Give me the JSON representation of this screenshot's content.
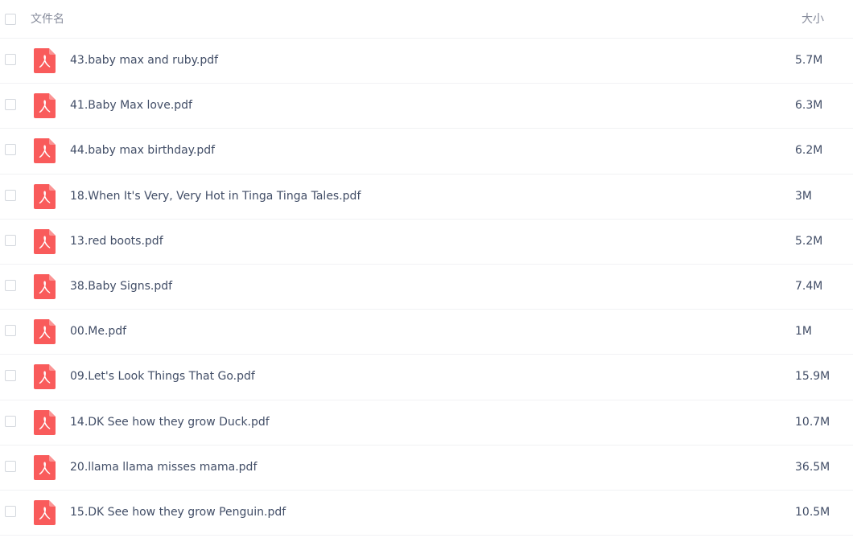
{
  "header": {
    "name_label": "文件名",
    "size_label": "大小"
  },
  "colors": {
    "pdf_icon": "#f95b5b",
    "divider": "#f1f2f4",
    "header_text": "#878c9c",
    "body_text": "#424e67"
  },
  "files": [
    {
      "name": "43.baby max and ruby.pdf",
      "size": "5.7M",
      "icon": "pdf-icon"
    },
    {
      "name": "41.Baby Max love.pdf",
      "size": "6.3M",
      "icon": "pdf-icon"
    },
    {
      "name": "44.baby max birthday.pdf",
      "size": "6.2M",
      "icon": "pdf-icon"
    },
    {
      "name": "18.When It's Very, Very Hot in Tinga Tinga Tales.pdf",
      "size": "3M",
      "icon": "pdf-icon"
    },
    {
      "name": "13.red boots.pdf",
      "size": "5.2M",
      "icon": "pdf-icon"
    },
    {
      "name": "38.Baby Signs.pdf",
      "size": "7.4M",
      "icon": "pdf-icon"
    },
    {
      "name": "00.Me.pdf",
      "size": "1M",
      "icon": "pdf-icon"
    },
    {
      "name": "09.Let's Look Things That Go.pdf",
      "size": "15.9M",
      "icon": "pdf-icon"
    },
    {
      "name": "14.DK See how they grow Duck.pdf",
      "size": "10.7M",
      "icon": "pdf-icon"
    },
    {
      "name": "20.llama llama misses mama.pdf",
      "size": "36.5M",
      "icon": "pdf-icon"
    },
    {
      "name": "15.DK See how they grow Penguin.pdf",
      "size": "10.5M",
      "icon": "pdf-icon"
    }
  ]
}
